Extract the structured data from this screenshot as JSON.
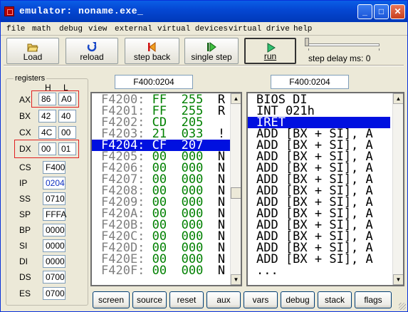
{
  "window": {
    "title": "emulator: noname.exe_",
    "controls": {
      "minimize": "_",
      "maximize": "□",
      "close": "✕"
    }
  },
  "menu": [
    "file",
    "math",
    "debug",
    "view",
    "external",
    "virtual devices",
    "virtual drive",
    "help"
  ],
  "toolbar": {
    "load": "Load",
    "reload": "reload",
    "step_back": "step back",
    "single_step": "single step",
    "run": "run",
    "step_delay": "step delay ms: 0"
  },
  "icons": {
    "load": "folder-open-icon",
    "reload": "reload-arrow-icon",
    "step_back": "step-back-icon",
    "single_step": "single-step-icon",
    "run": "run-play-icon"
  },
  "colors": {
    "selection": "#0010e0",
    "hex_values": "#008000",
    "address_gray": "#808080",
    "highlight_border": "#e02020"
  },
  "registers": {
    "title": "registers",
    "h_label": "H",
    "l_label": "L",
    "pairs": [
      {
        "name": "AX",
        "h": "86",
        "l": "A0"
      },
      {
        "name": "BX",
        "h": "42",
        "l": "40"
      },
      {
        "name": "CX",
        "h": "4C",
        "l": "00"
      },
      {
        "name": "DX",
        "h": "00",
        "l": "01"
      }
    ],
    "singles": [
      {
        "name": "CS",
        "value": "F400"
      },
      {
        "name": "IP",
        "value": "0204"
      },
      {
        "name": "SS",
        "value": "0710"
      },
      {
        "name": "SP",
        "value": "FFFA"
      },
      {
        "name": "BP",
        "value": "0000"
      },
      {
        "name": "SI",
        "value": "0000"
      },
      {
        "name": "DI",
        "value": "0000"
      },
      {
        "name": "DS",
        "value": "0700"
      },
      {
        "name": "ES",
        "value": "0700"
      }
    ]
  },
  "memory": {
    "address": "F400:0204",
    "rows": [
      {
        "addr": "F4200:",
        "hex": "FF",
        "dec": "255",
        "ch": "R"
      },
      {
        "addr": "F4201:",
        "hex": "FF",
        "dec": "255",
        "ch": "R"
      },
      {
        "addr": "F4202:",
        "hex": "CD",
        "dec": "205",
        "ch": ""
      },
      {
        "addr": "F4203:",
        "hex": "21",
        "dec": "033",
        "ch": "!"
      },
      {
        "addr": "F4204:",
        "hex": "CF",
        "dec": "207",
        "ch": ""
      },
      {
        "addr": "F4205:",
        "hex": "00",
        "dec": "000",
        "ch": "N"
      },
      {
        "addr": "F4206:",
        "hex": "00",
        "dec": "000",
        "ch": "N"
      },
      {
        "addr": "F4207:",
        "hex": "00",
        "dec": "000",
        "ch": "N"
      },
      {
        "addr": "F4208:",
        "hex": "00",
        "dec": "000",
        "ch": "N"
      },
      {
        "addr": "F4209:",
        "hex": "00",
        "dec": "000",
        "ch": "N"
      },
      {
        "addr": "F420A:",
        "hex": "00",
        "dec": "000",
        "ch": "N"
      },
      {
        "addr": "F420B:",
        "hex": "00",
        "dec": "000",
        "ch": "N"
      },
      {
        "addr": "F420C:",
        "hex": "00",
        "dec": "000",
        "ch": "N"
      },
      {
        "addr": "F420D:",
        "hex": "00",
        "dec": "000",
        "ch": "N"
      },
      {
        "addr": "F420E:",
        "hex": "00",
        "dec": "000",
        "ch": "N"
      },
      {
        "addr": "F420F:",
        "hex": "00",
        "dec": "000",
        "ch": "N"
      }
    ],
    "selected_index": 4
  },
  "disassembly": {
    "address": "F400:0204",
    "lines": [
      "BIOS DI",
      "INT 021h",
      "IRET",
      "ADD [BX + SI], A",
      "ADD [BX + SI], A",
      "ADD [BX + SI], A",
      "ADD [BX + SI], A",
      "ADD [BX + SI], A",
      "ADD [BX + SI], A",
      "ADD [BX + SI], A",
      "ADD [BX + SI], A",
      "ADD [BX + SI], A",
      "ADD [BX + SI], A",
      "ADD [BX + SI], A",
      "ADD [BX + SI], A",
      "..."
    ],
    "selected_index": 2
  },
  "bottom_buttons": [
    "screen",
    "source",
    "reset",
    "aux",
    "vars",
    "debug",
    "stack",
    "flags"
  ]
}
